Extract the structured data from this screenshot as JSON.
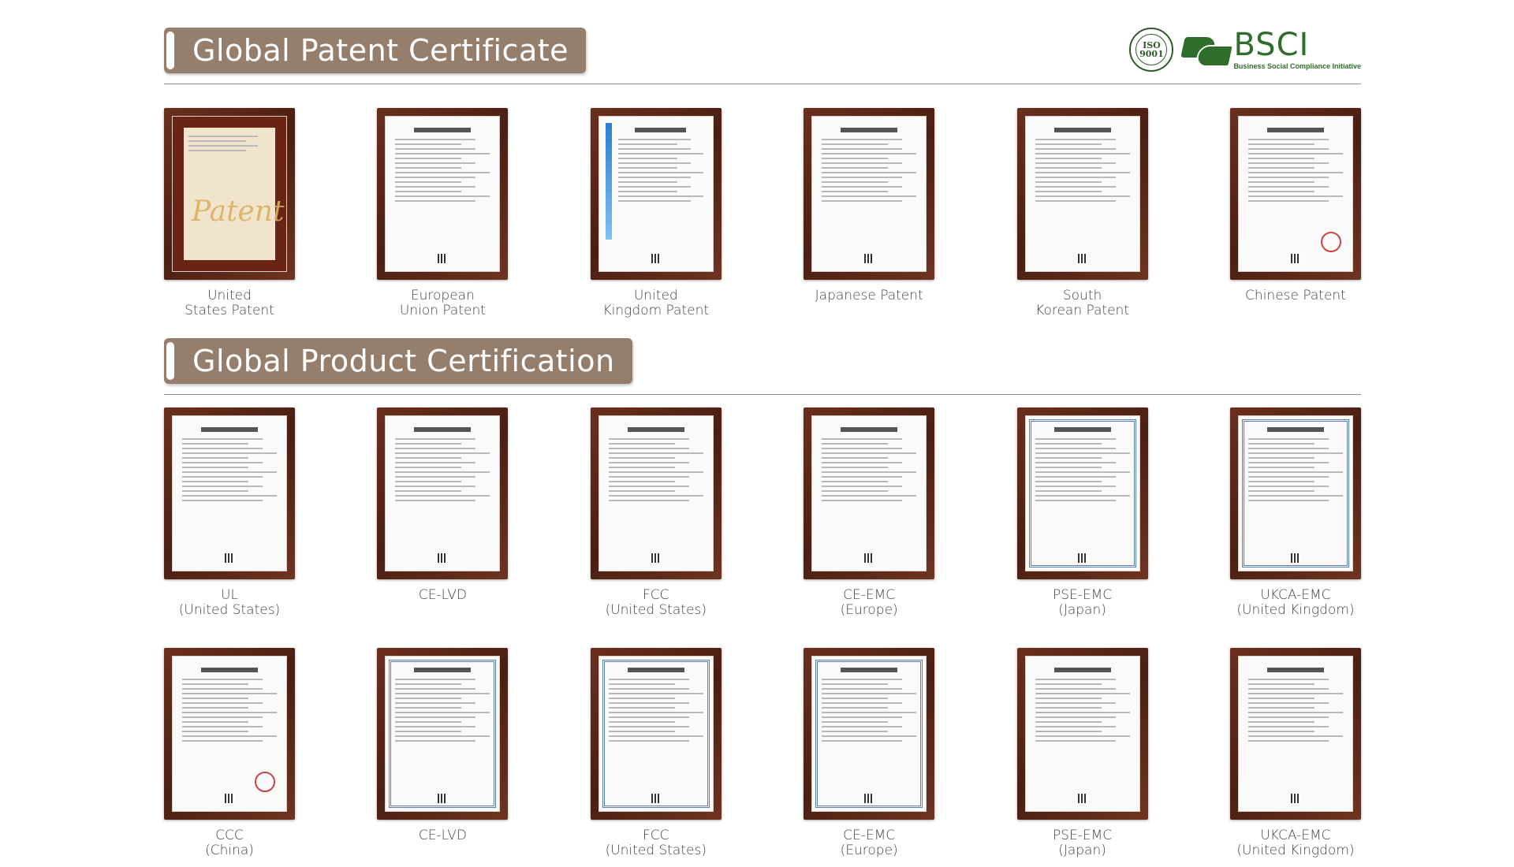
{
  "patents": {
    "title": "Global Patent Certificate",
    "items": [
      {
        "label": "United\nStates Patent",
        "style": "gold"
      },
      {
        "label": "European\nUnion Patent",
        "style": "plain"
      },
      {
        "label": "United\nKingdom Patent",
        "style": "bluebar"
      },
      {
        "label": "Japanese Patent",
        "style": "plain"
      },
      {
        "label": "South\nKorean Patent",
        "style": "plain"
      },
      {
        "label": "Chinese Patent",
        "style": "stamp"
      }
    ]
  },
  "certifications": {
    "title": "Global Product Certification",
    "items": [
      {
        "label": "UL\n(United States)",
        "style": "plain"
      },
      {
        "label": "CE-LVD",
        "style": "plain"
      },
      {
        "label": "FCC\n(United States)",
        "style": "plain"
      },
      {
        "label": "CE-EMC\n(Europe)",
        "style": "plain"
      },
      {
        "label": "PSE-EMC\n(Japan)",
        "style": "blue"
      },
      {
        "label": "UKCA-EMC\n(United Kingdom)",
        "style": "blue"
      },
      {
        "label": "CCC\n(China)",
        "style": "stamp"
      },
      {
        "label": "CE-LVD",
        "style": "blue"
      },
      {
        "label": "FCC\n(United States)",
        "style": "blue"
      },
      {
        "label": "CE-EMC\n(Europe)",
        "style": "blue"
      },
      {
        "label": "PSE-EMC\n(Japan)",
        "style": "plain"
      },
      {
        "label": "UKCA-EMC\n(United Kingdom)",
        "style": "plain"
      }
    ]
  },
  "logos": {
    "iso_line1": "ISO",
    "iso_line2": "9001",
    "bsci_name": "BSCI",
    "bsci_tagline": "Business Social Compliance Initiative"
  },
  "colors": {
    "header_bg": "#957e6b",
    "frame": "#5a2617",
    "logo_green": "#2f6d2a"
  }
}
